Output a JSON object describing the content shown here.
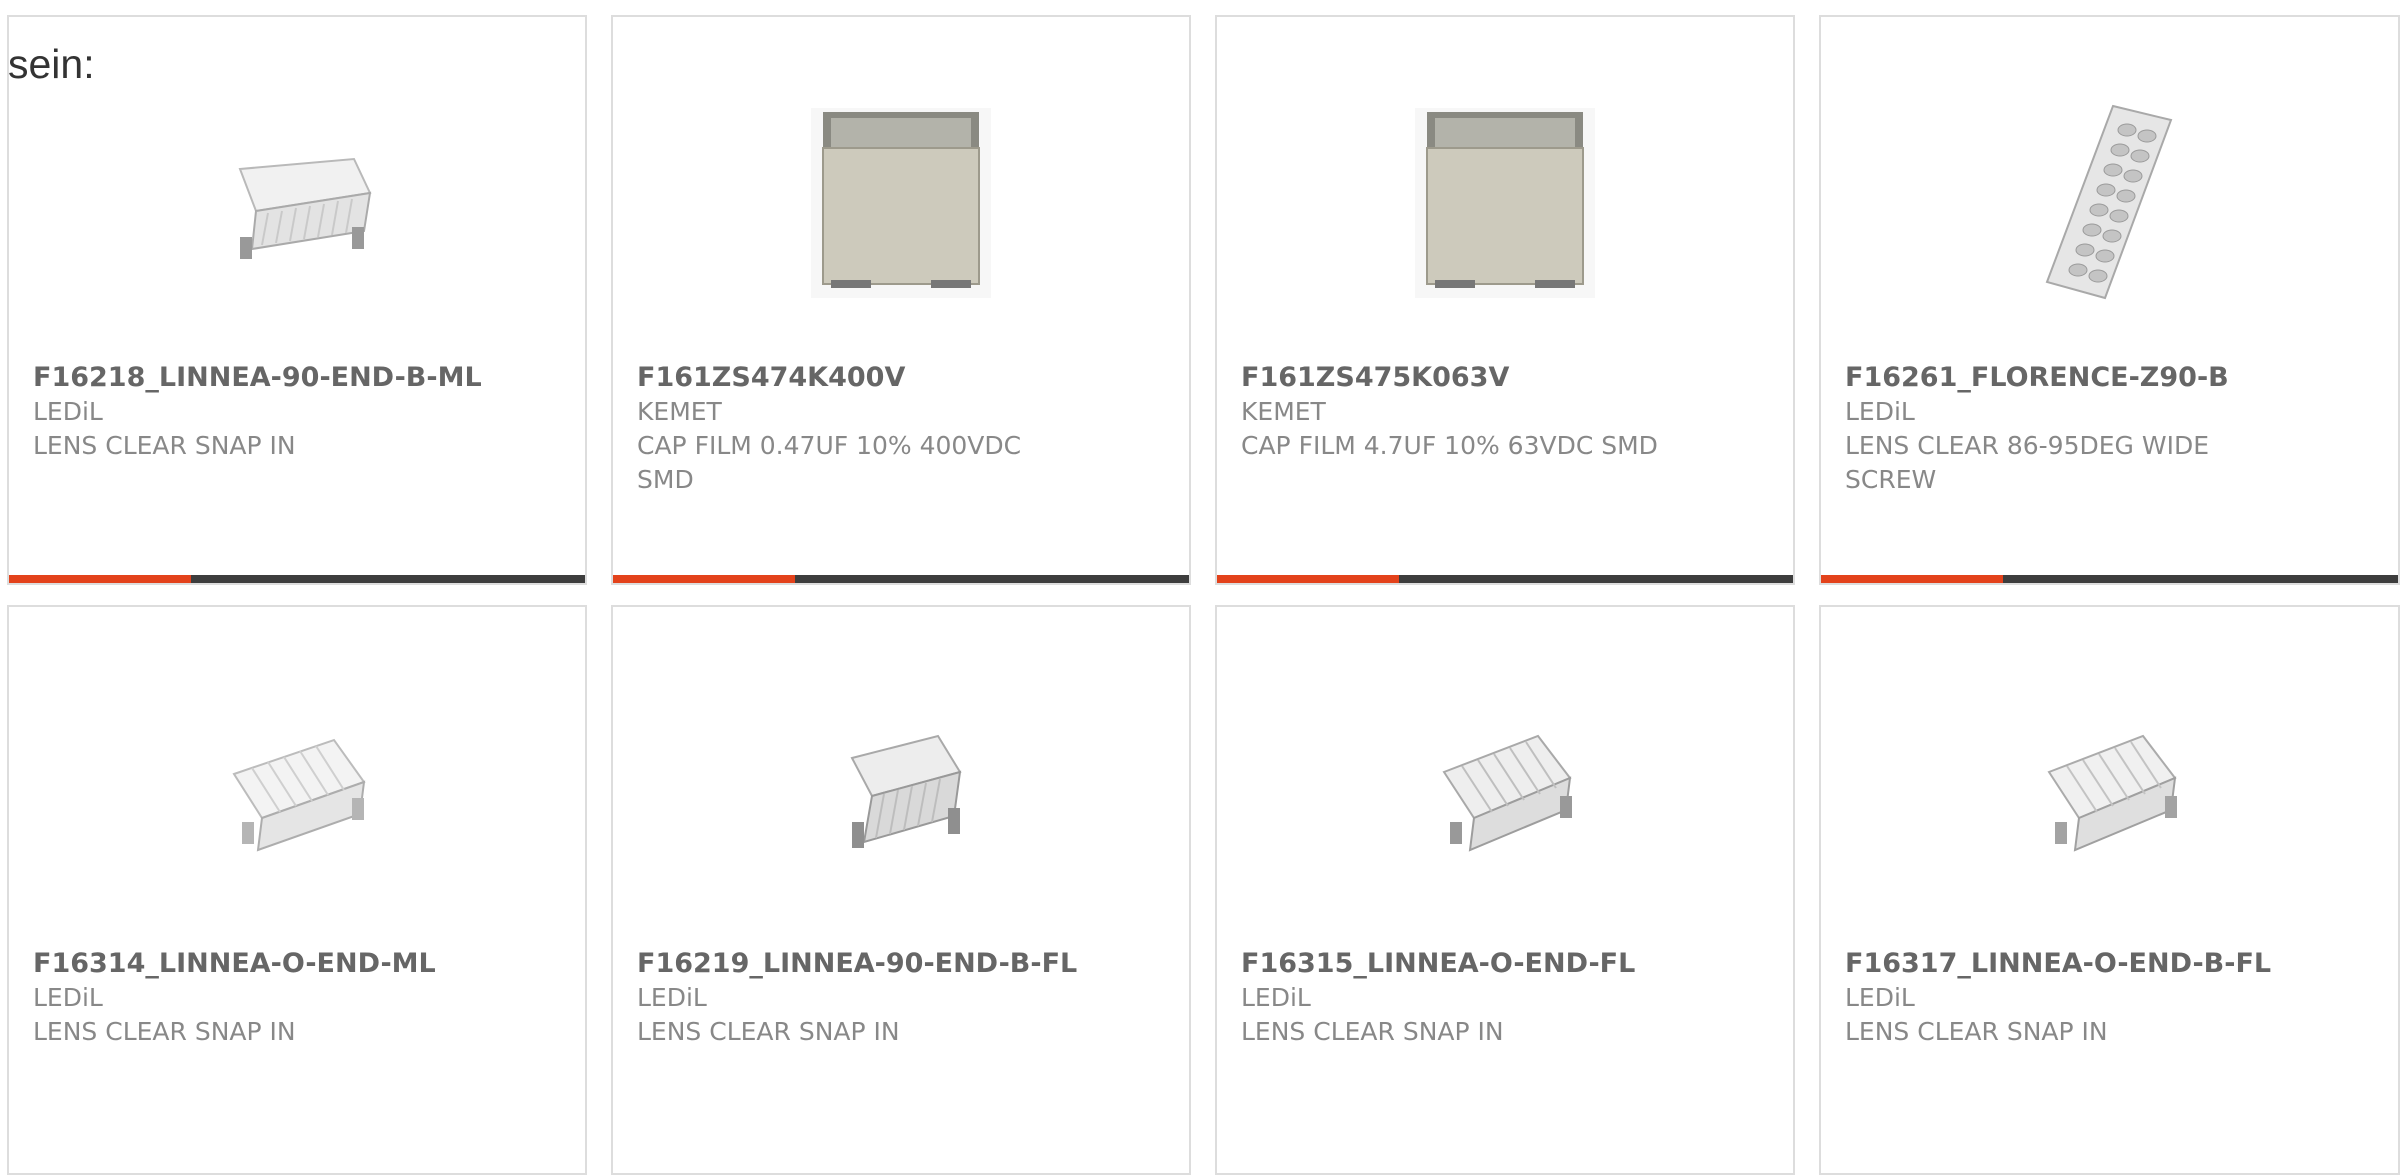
{
  "page": {
    "intro_text": "sein:"
  },
  "products": [
    {
      "part_number": "F16218_LINNEA-90-END-B-ML",
      "manufacturer": "LEDiL",
      "description": "LENS CLEAR SNAP IN",
      "image": "lens-clip"
    },
    {
      "part_number": "F161ZS474K400V",
      "manufacturer": "KEMET",
      "description": "CAP FILM 0.47UF 10% 400VDC SMD",
      "image": "film-capacitor"
    },
    {
      "part_number": "F161ZS475K063V",
      "manufacturer": "KEMET",
      "description": "CAP FILM 4.7UF 10% 63VDC SMD",
      "image": "film-capacitor"
    },
    {
      "part_number": "F16261_FLORENCE-Z90-B",
      "manufacturer": "LEDiL",
      "description": "LENS CLEAR 86-95DEG WIDE SCREW",
      "image": "lens-strip"
    },
    {
      "part_number": "F16314_LINNEA-O-END-ML",
      "manufacturer": "LEDiL",
      "description": "LENS CLEAR SNAP IN",
      "image": "lens-clip"
    },
    {
      "part_number": "F16219_LINNEA-90-END-B-FL",
      "manufacturer": "LEDiL",
      "description": "LENS CLEAR SNAP IN",
      "image": "lens-clip"
    },
    {
      "part_number": "F16315_LINNEA-O-END-FL",
      "manufacturer": "LEDiL",
      "description": "LENS CLEAR SNAP IN",
      "image": "lens-clip"
    },
    {
      "part_number": "F16317_LINNEA-O-END-B-FL",
      "manufacturer": "LEDiL",
      "description": "LENS CLEAR SNAP IN",
      "image": "lens-clip"
    }
  ],
  "colors": {
    "accent": "#e3421b",
    "bar": "#3d3d3d",
    "border": "#dddddd",
    "text": "#777777"
  }
}
